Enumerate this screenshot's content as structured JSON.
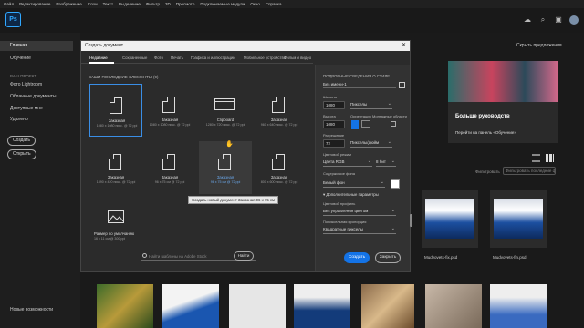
{
  "menubar": [
    "Файл",
    "Редактирование",
    "Изображение",
    "Слои",
    "Текст",
    "Выделение",
    "Фильтр",
    "3D",
    "Просмотр",
    "Подключаемые модули",
    "Окно",
    "Справка"
  ],
  "app": {
    "logo": "Ps"
  },
  "sidebar": {
    "home": "Главная",
    "learn": "Обучение",
    "section": "ВАШ ПРОЕКТ",
    "items": [
      "Фото Lightroom",
      "Облачные документы",
      "Доступные мне",
      "Удалено"
    ],
    "create_btn": "Создать",
    "open_btn": "Открыть",
    "whats_new": "Новые возможности"
  },
  "home": {
    "hide_suggestions": "Скрыть предложения",
    "promo_title": "Больше руководств",
    "promo_link": "Перейти на панель «Обучение»",
    "filter_label": "Фильтровать",
    "filter_placeholder": "Фильтровать последние файлы",
    "files": [
      {
        "name": "Mudvovets-fix.psd"
      },
      {
        "name": "Mudvovets-fin.psd"
      }
    ]
  },
  "dialog": {
    "title": "Создать документ",
    "close": "✕",
    "tabs": [
      "Недавние",
      "Сохраненные",
      "Фото",
      "Печать",
      "Графика и иллюстрации",
      "Мобильное устройство",
      "Фильм и видео"
    ],
    "recent_label": "ВАШИ ПОСЛЕДНИЕ ЭЛЕМЕНТЫ  (9)",
    "presets": [
      {
        "name": "Заказная",
        "meta": "1080 x 1080 пикс. @ 72 ppi"
      },
      {
        "name": "Заказная",
        "meta": "1080 x 1080 пикс. @ 72 ppi"
      },
      {
        "name": "Clipboard",
        "meta": "1280 x 720 пикс. @ 72 ppi"
      },
      {
        "name": "Заказная",
        "meta": "960 x 640 пикс. @ 72 ppi"
      },
      {
        "name": "Заказная",
        "meta": "1390 x 420 пикс. @ 72 ppi"
      },
      {
        "name": "Заказная",
        "meta": "96 x 75 см @ 72 ppi"
      },
      {
        "name": "Заказная",
        "meta": "96 x 75 см @ 72 ppi"
      },
      {
        "name": "Заказная",
        "meta": "800 x 600 пикс. @ 72 ppi"
      },
      {
        "name": "Размер по умолчанию",
        "meta": "16 x 11 см @ 300 ppi"
      }
    ],
    "tooltip": "Создать новый документ Заказная 96 x 75 см",
    "search_placeholder": "Найти шаблоны на Adobe Stock",
    "go_btn": "Найти",
    "details": {
      "heading": "ПОДРОБНЫЕ СВЕДЕНИЯ О СТИЛЕ",
      "name": "Без имени-1",
      "width_label": "Ширина",
      "width": "1080",
      "width_unit": "Пикселы",
      "height_label": "Высота",
      "height": "1080",
      "orientation_label": "Ориентация",
      "artboards_label": "Монтажные области",
      "resolution_label": "Разрешение",
      "resolution": "72",
      "resolution_unit": "Пикселы/дюйм",
      "color_mode_label": "Цветовой режим",
      "color_mode": "Цвета RGB",
      "bit_depth": "8 бит",
      "background_label": "Содержимое фона",
      "background": "Белый фон",
      "advanced": "Дополнительные параметры",
      "profile_label": "Цветовой профиль",
      "profile": "Без управления цветом",
      "pixel_aspect_label": "Попиксельная пропорция",
      "pixel_aspect": "Квадратные пикселы"
    },
    "create_btn": "Создать",
    "close_btn": "Закрыть"
  }
}
